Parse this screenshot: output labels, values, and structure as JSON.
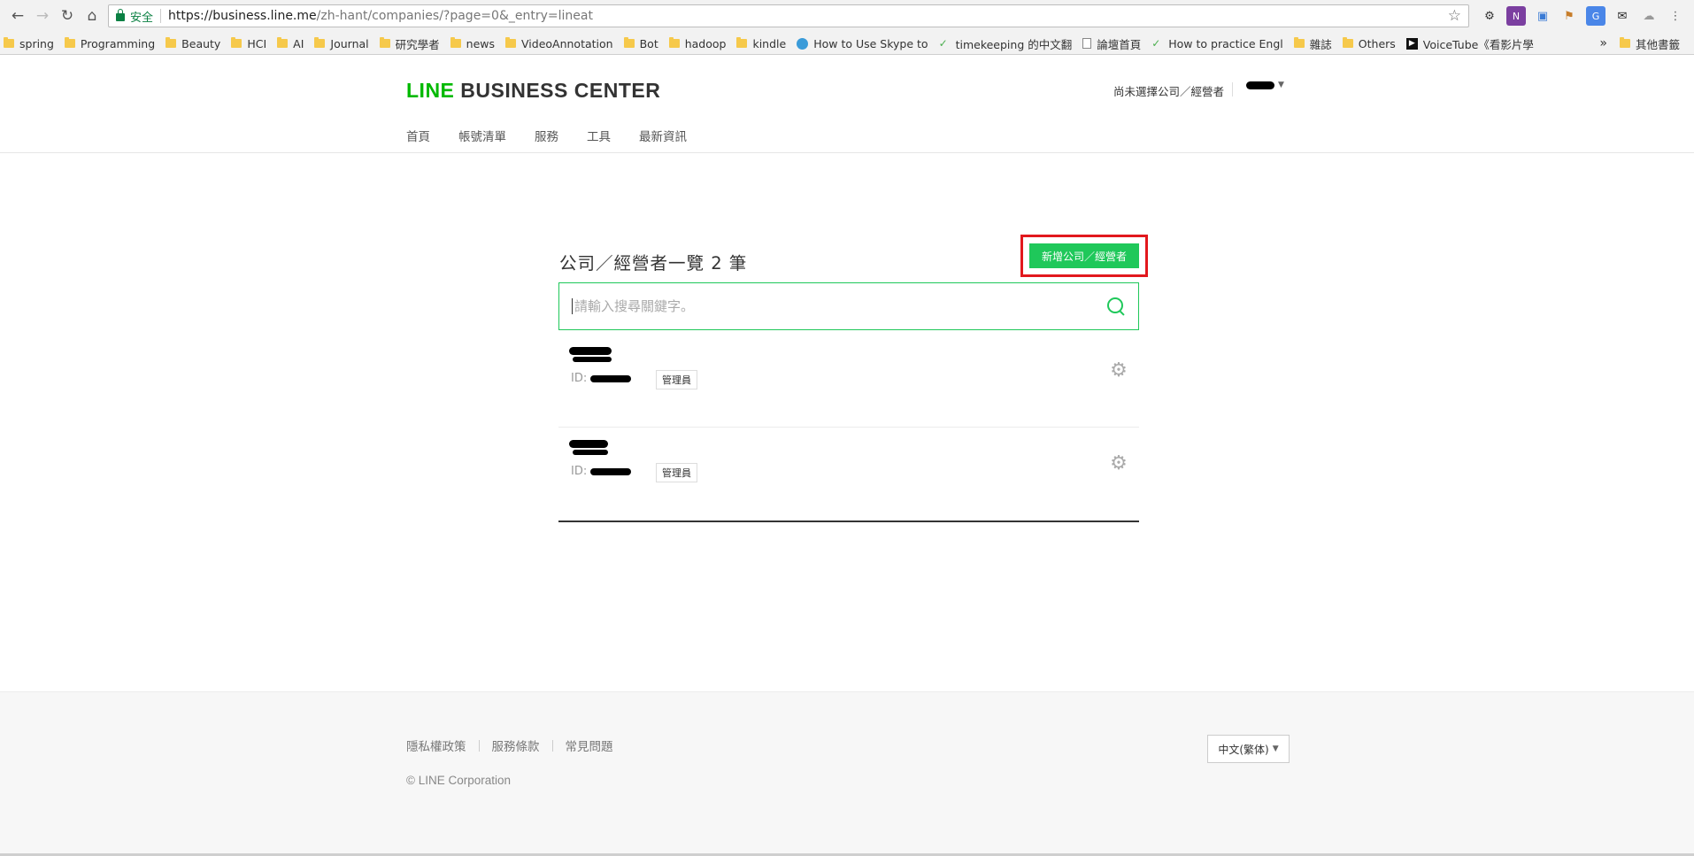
{
  "browser": {
    "secure_label": "安全",
    "url_host": "https://business.line.me",
    "url_path": "/zh-hant/companies/?page=0&_entry=lineat",
    "bookmarks": [
      {
        "label": "spring",
        "icon": "folder-icon"
      },
      {
        "label": "Programming",
        "icon": "folder-icon"
      },
      {
        "label": "Beauty",
        "icon": "folder-icon"
      },
      {
        "label": "HCI",
        "icon": "folder-icon"
      },
      {
        "label": "AI",
        "icon": "folder-icon"
      },
      {
        "label": "Journal",
        "icon": "folder-icon"
      },
      {
        "label": "研究學者",
        "icon": "folder-icon"
      },
      {
        "label": "news",
        "icon": "folder-icon"
      },
      {
        "label": "VideoAnnotation",
        "icon": "folder-icon"
      },
      {
        "label": "Bot",
        "icon": "folder-icon"
      },
      {
        "label": "hadoop",
        "icon": "folder-icon"
      },
      {
        "label": "kindle",
        "icon": "folder-icon"
      },
      {
        "label": "How to Use Skype to",
        "icon": "globe-icon"
      },
      {
        "label": "timekeeping 的中文翻",
        "icon": "leaf-icon"
      },
      {
        "label": "論壇首頁",
        "icon": "page-icon"
      },
      {
        "label": "How to practice Engl",
        "icon": "leaf-icon"
      },
      {
        "label": "雜誌",
        "icon": "folder-icon"
      },
      {
        "label": "Others",
        "icon": "folder-icon"
      },
      {
        "label": "VoiceTube《看影片學",
        "icon": "voicetube-icon"
      }
    ],
    "other_bookmarks": "其他書籤",
    "more_label": "»"
  },
  "header": {
    "logo_green": "LINE",
    "logo_dark": "BUSINESS CENTER",
    "company_select": "尚未選擇公司／經營者",
    "nav": [
      "首頁",
      "帳號清單",
      "服務",
      "工具",
      "最新資訊"
    ]
  },
  "main": {
    "title": "公司／經營者一覽 2 筆",
    "add_button": "新增公司／經營者",
    "search_placeholder": "請輸入搜尋關鍵字。",
    "companies": [
      {
        "id_label": "ID:",
        "role": "管理員"
      },
      {
        "id_label": "ID:",
        "role": "管理員"
      }
    ]
  },
  "footer": {
    "links": [
      "隱私權政策",
      "服務條款",
      "常見問題"
    ],
    "copyright": "© LINE Corporation",
    "language": "中文(繁体)"
  },
  "colors": {
    "line_green": "#00b900",
    "button_green": "#1fc85a",
    "highlight_red": "#e2181d"
  }
}
